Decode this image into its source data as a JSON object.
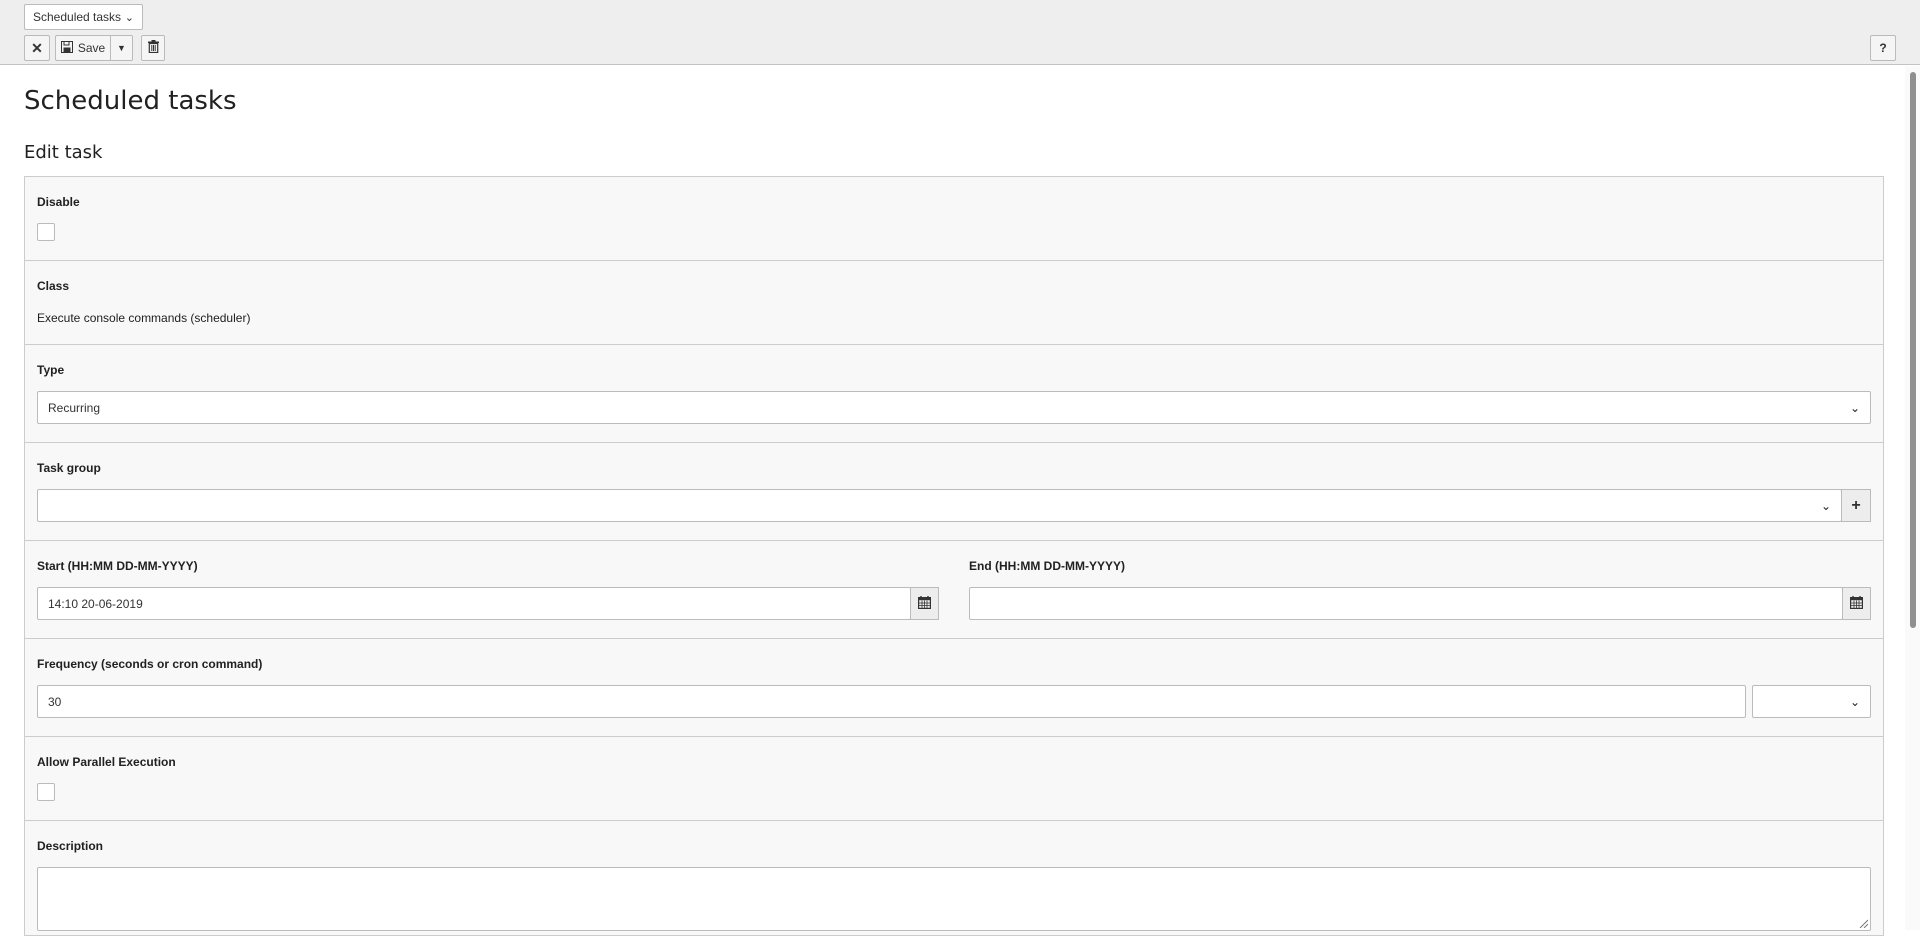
{
  "header": {
    "module_select": "Scheduled tasks",
    "close_label": "✕",
    "save_label": "Save",
    "help_label": "?"
  },
  "page": {
    "title": "Scheduled tasks",
    "section": "Edit task"
  },
  "form": {
    "disable": {
      "label": "Disable",
      "checked": false
    },
    "class": {
      "label": "Class",
      "value": "Execute console commands (scheduler)"
    },
    "type": {
      "label": "Type",
      "value": "Recurring"
    },
    "task_group": {
      "label": "Task group",
      "value": "",
      "add_label": "+"
    },
    "start": {
      "label": "Start (HH:MM DD-MM-YYYY)",
      "value": "14:10 20-06-2019"
    },
    "end": {
      "label": "End (HH:MM DD-MM-YYYY)",
      "value": ""
    },
    "frequency": {
      "label": "Frequency (seconds or cron command)",
      "value": "30",
      "preset": ""
    },
    "parallel": {
      "label": "Allow Parallel Execution",
      "checked": false
    },
    "description": {
      "label": "Description",
      "value": ""
    }
  },
  "icons": {
    "close": "close-icon",
    "save": "floppy-disk-icon",
    "split": "caret-down-icon",
    "delete": "trash-icon",
    "help": "help-icon",
    "calendar": "calendar-icon",
    "add": "plus-icon"
  },
  "colors": {
    "header_bg": "#eeeeee",
    "form_bg": "#f8f8f8",
    "border": "#cccccc"
  }
}
